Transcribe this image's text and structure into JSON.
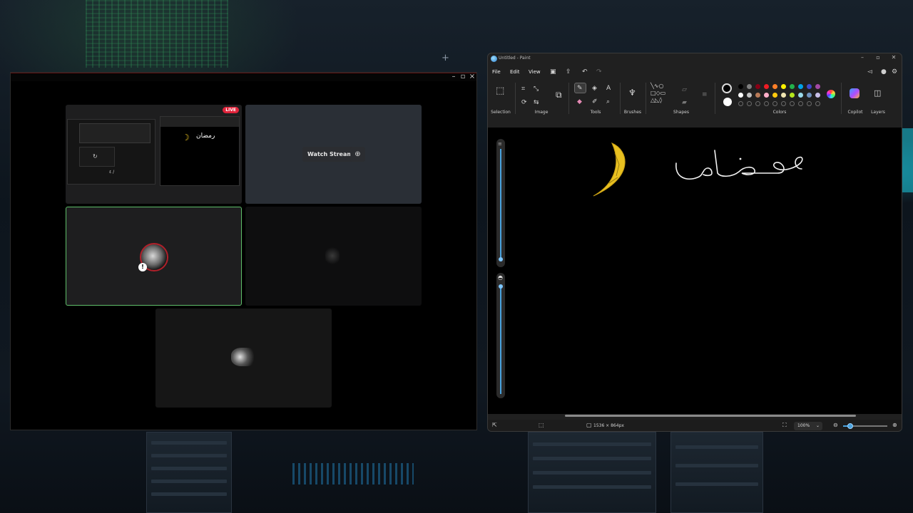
{
  "viewer": {
    "live_badge": "LIVE",
    "watch_stream_label": "Watch Stream",
    "thumb_text": "٤ /"
  },
  "paint": {
    "title": "Untitled - Paint",
    "menu": [
      "File",
      "Edit",
      "View"
    ],
    "groups": {
      "selection": "Selection",
      "image": "Image",
      "tools": "Tools",
      "brushes": "Brushes",
      "shapes": "Shapes",
      "colors": "Colors",
      "copilot": "Copilot",
      "layers": "Layers"
    },
    "canvas": {
      "handwriting": "رمضان"
    },
    "status": {
      "canvas_size": "1536 × 864px",
      "zoom": "100%"
    },
    "palette_row1": [
      "#000000",
      "#7f7f7f",
      "#880015",
      "#ed1c24",
      "#ff7f27",
      "#fff200",
      "#22b14c",
      "#00a2e8",
      "#3f48cc",
      "#a349a4"
    ],
    "palette_row2": [
      "#ffffff",
      "#c3c3c3",
      "#b97a57",
      "#ffaec9",
      "#ffc90e",
      "#efe4b0",
      "#b5e61d",
      "#99d9ea",
      "#7092be",
      "#c8bfe7"
    ]
  },
  "accent": {
    "live_red": "#e0233a",
    "active_tile_border": "#5fbf6a",
    "paint_blue": "#4aa3df",
    "moon_yellow": "#e8c020"
  }
}
